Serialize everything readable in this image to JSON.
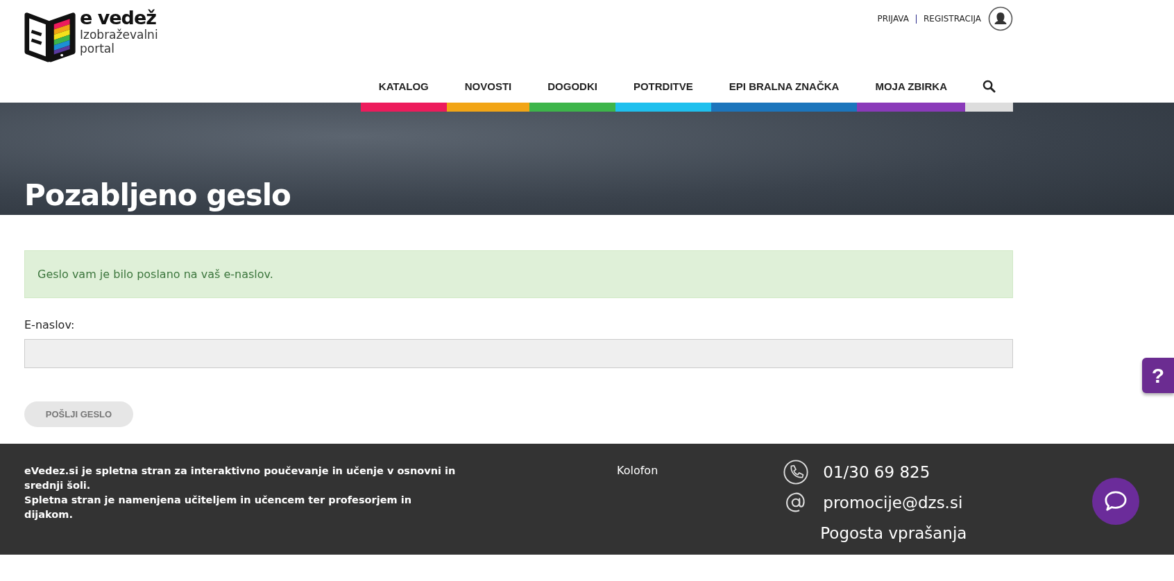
{
  "logo": {
    "brand": "e vedež",
    "subtitle": "Izobraževalni portal"
  },
  "account": {
    "links": [
      "PRIJAVA",
      "REGISTRACIJA"
    ]
  },
  "nav": [
    {
      "label": "KATALOG",
      "color": "#ed1b5c"
    },
    {
      "label": "NOVOSTI",
      "color": "#f2a515"
    },
    {
      "label": "DOGODKI",
      "color": "#3db54a"
    },
    {
      "label": "POTRDITVE",
      "color": "#1fc0ee"
    },
    {
      "label": "EPI BRALNA ZNAČKA",
      "color": "#1c75bc"
    },
    {
      "label": "MOJA ZBIRKA",
      "color": "#8a3ab9"
    }
  ],
  "page_title": "Pozabljeno geslo",
  "alert": "Geslo vam je bilo poslano na vaš e-naslov.",
  "form": {
    "label": "E-naslov:",
    "submit": "POŠLJI GESLO",
    "submit_disabled": true
  },
  "help_tab": "?",
  "footer": {
    "about": [
      "eVedez.si je spletna stran za interaktivno poučevanje in učenje v osnovni in srednji šoli.",
      "Spletna stran je namenjena učiteljem in učencem ter profesorjem in dijakom."
    ],
    "kolofon": "Kolofon",
    "phone": "01/30 69 825",
    "email": "promocije@dzs.si",
    "faq": "Pogosta vprašanja"
  }
}
